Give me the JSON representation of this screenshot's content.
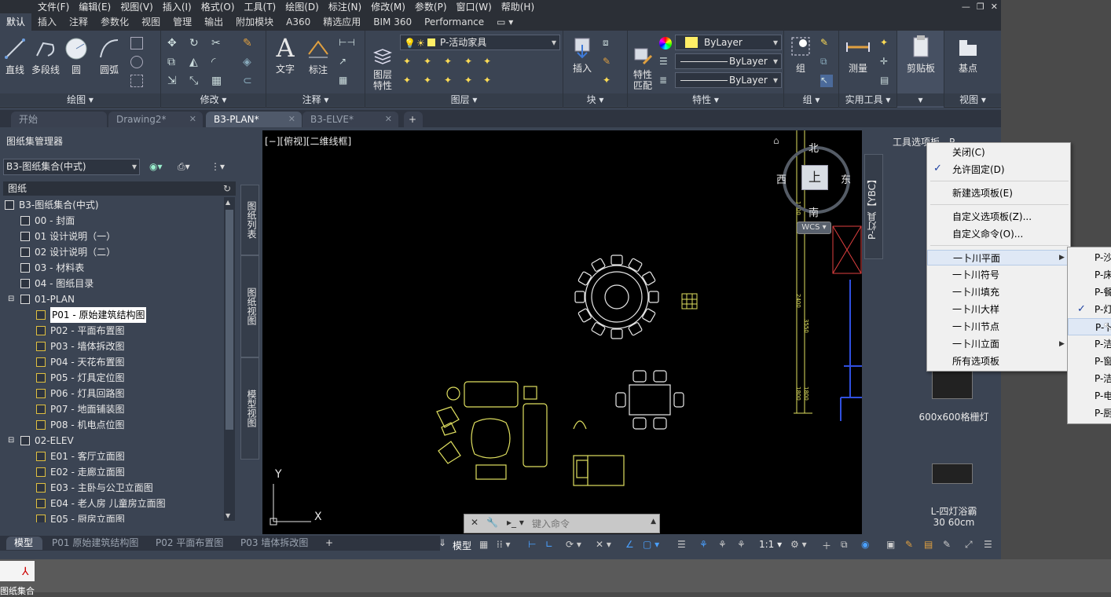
{
  "menubar": {
    "items": [
      "文件(F)",
      "编辑(E)",
      "视图(V)",
      "插入(I)",
      "格式(O)",
      "工具(T)",
      "绘图(D)",
      "标注(N)",
      "修改(M)",
      "参数(P)",
      "窗口(W)",
      "帮助(H)"
    ]
  },
  "ribbon_tabs": [
    "默认",
    "插入",
    "注释",
    "参数化",
    "视图",
    "管理",
    "输出",
    "附加模块",
    "A360",
    "精选应用",
    "BIM 360",
    "Performance"
  ],
  "ribbon": {
    "draw": {
      "line": "直线",
      "polyline": "多段线",
      "circle": "圆",
      "arc": "圆弧",
      "label": "绘图 ▾"
    },
    "modify": {
      "label": "修改 ▾"
    },
    "annotation": {
      "text": "文字",
      "dimension": "标注",
      "label": "注释 ▾"
    },
    "layers": {
      "props": "图层\n特性",
      "current_layer": "P-活动家具",
      "label": "图层 ▾"
    },
    "block": {
      "insert": "插入",
      "label": "块 ▾"
    },
    "properties": {
      "match": "特性\n匹配",
      "color": "ByLayer",
      "linetype": "ByLayer",
      "lineweight": "ByLayer",
      "label": "特性 ▾"
    },
    "groups": {
      "group": "组",
      "label": "组 ▾"
    },
    "utilities": {
      "measure": "测量",
      "label": "实用工具 ▾"
    },
    "clipboard": {
      "paste": "剪贴板",
      "label": "▾"
    },
    "view": {
      "base": "基点",
      "label": "视图 ▾"
    }
  },
  "doc_tabs": [
    "开始",
    "Drawing2*",
    "B3-PLAN*",
    "B3-ELVE*"
  ],
  "sheet_set": {
    "title": "图纸集管理器",
    "combo": "B3-图纸集合(中式)",
    "sheets_header": "图纸",
    "tree": [
      {
        "label": "B3-图纸集合(中式)",
        "level": 0
      },
      {
        "label": "00 - 封面",
        "level": 1
      },
      {
        "label": "01 设计说明（一）",
        "level": 1
      },
      {
        "label": "02 设计说明（二）",
        "level": 1
      },
      {
        "label": "03 - 材料表",
        "level": 1
      },
      {
        "label": "04 - 图纸目录",
        "level": 1
      },
      {
        "label": "01-PLAN",
        "level": 1
      },
      {
        "label": "P01 - 原始建筑结构图",
        "level": 2
      },
      {
        "label": "P02 - 平面布置图",
        "level": 2
      },
      {
        "label": "P03 - 墙体拆改图",
        "level": 2
      },
      {
        "label": "P04 - 天花布置图",
        "level": 2
      },
      {
        "label": "P05 - 灯具定位图",
        "level": 2
      },
      {
        "label": "P06 - 灯具回路图",
        "level": 2
      },
      {
        "label": "P07 - 地面铺装图",
        "level": 2
      },
      {
        "label": "P08 - 机电点位图",
        "level": 2
      },
      {
        "label": "02-ELEV",
        "level": 1
      },
      {
        "label": "E01 - 客厅立面图",
        "level": 2
      },
      {
        "label": "E02 - 走廊立面图",
        "level": 2
      },
      {
        "label": "E03 - 主卧与公卫立面图",
        "level": 2
      },
      {
        "label": "E04 - 老人房 儿童房立面图",
        "level": 2
      },
      {
        "label": "E05 - 厨房立面图",
        "level": 2
      }
    ],
    "side_tabs": [
      "图纸列表",
      "图纸视图",
      "模型视图"
    ]
  },
  "canvas": {
    "view_label": "[−][俯视][二维线框]",
    "viewcube": {
      "north": "北",
      "south": "南",
      "east": "东",
      "west": "西",
      "top": "上",
      "wcs": "WCS"
    },
    "ucs": {
      "x": "X",
      "y": "Y"
    },
    "dims": [
      "1800",
      "2400",
      "3550",
      "1800",
      "1800"
    ]
  },
  "command_line": {
    "placeholder": "键入命令"
  },
  "tool_palette": {
    "title": "工具选项板 - P...",
    "vertical_tab": "P-灯具【YBC】",
    "item1": "600x600格栅灯",
    "item2": "L-四灯浴霸\n30 60cm"
  },
  "context_menu": {
    "items": [
      "关闭(C)",
      "允许固定(D)",
      "新建选项板(E)",
      "自定义选项板(Z)...",
      "自定义命令(O)...",
      "一卜川平面",
      "一卜川符号",
      "一卜川填充",
      "一卜川大样",
      "一卜川节点",
      "一卜川立面",
      "所有选项板"
    ]
  },
  "submenu": {
    "items": [
      "P-沙",
      "P-床",
      "P-餐",
      "P-灯",
      "P-卜",
      "P-洁",
      "P-窗",
      "P-洁",
      "P-电",
      "P-厨"
    ]
  },
  "layout_tabs": [
    "模型",
    "P01 原始建筑结构图",
    "P02 平面布置图",
    "P03 墙体拆改图"
  ],
  "status": {
    "model": "模型",
    "scale": "1:1"
  },
  "desktop": {
    "icon_label": "图纸集合"
  }
}
